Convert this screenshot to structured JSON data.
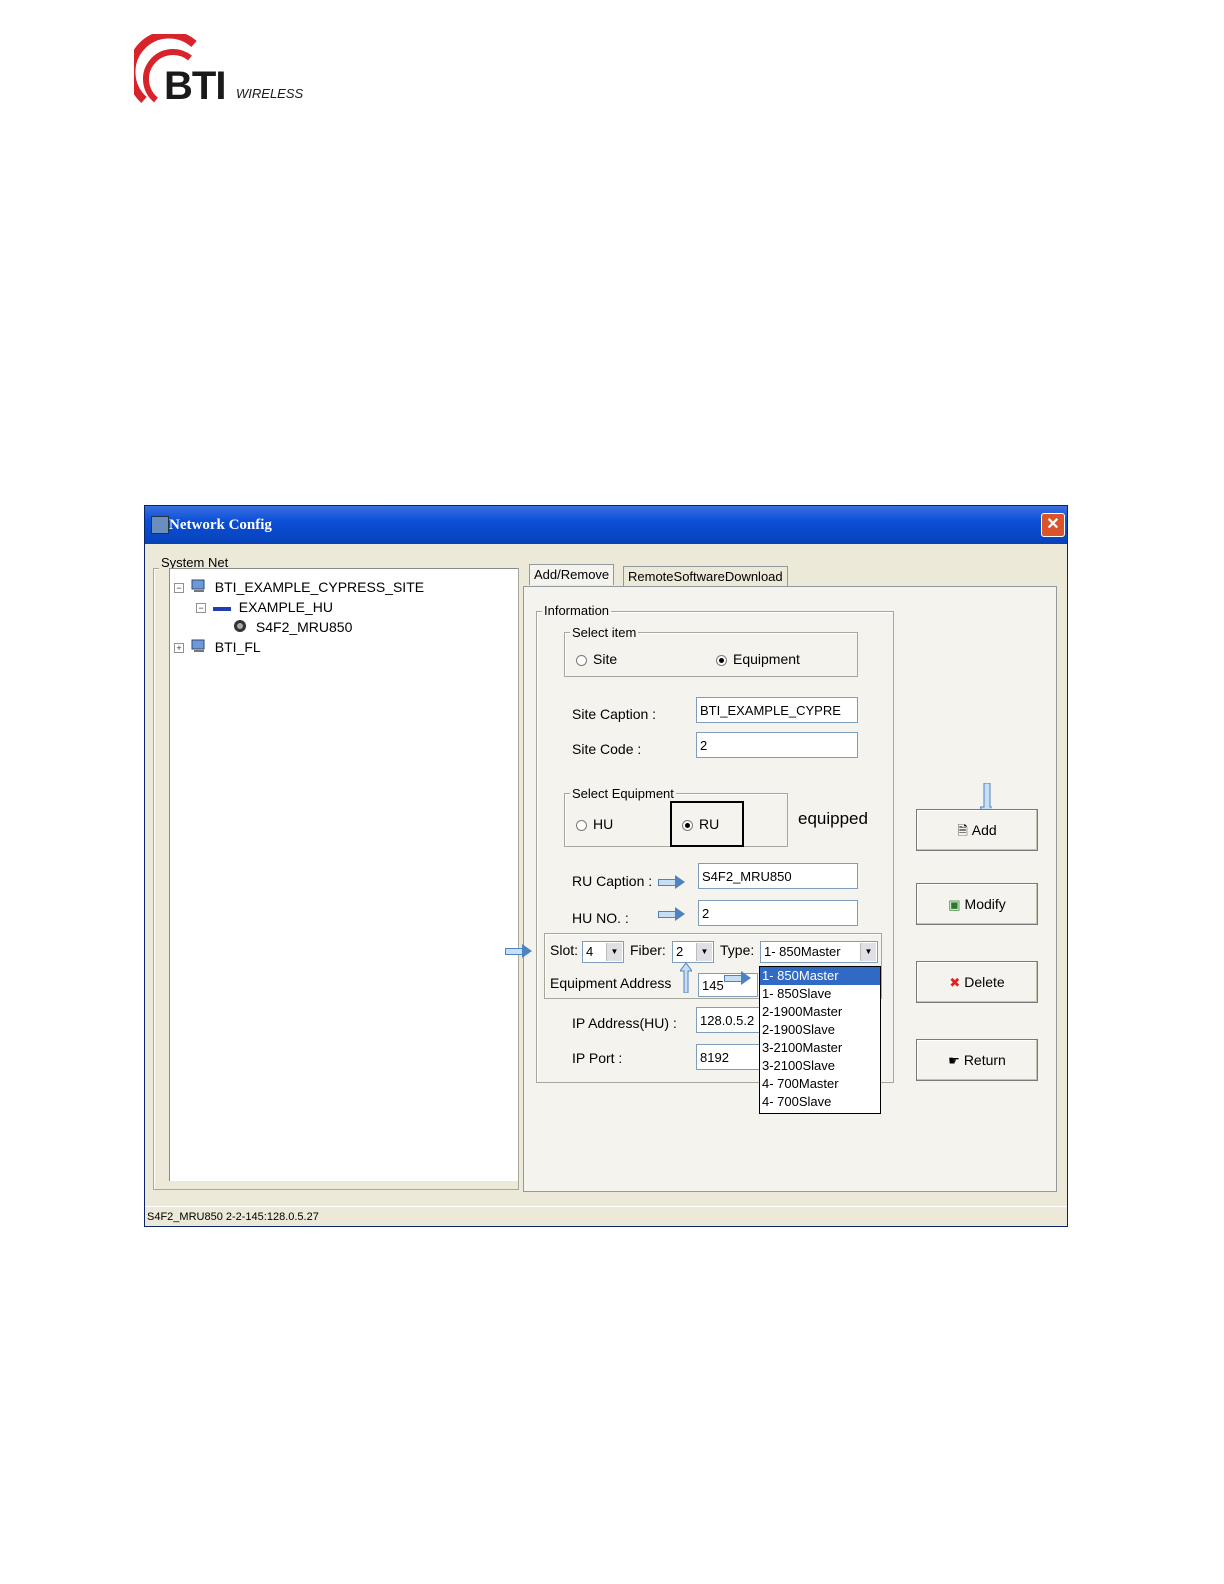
{
  "logo": {
    "main": "BTI",
    "sub": "WIRELESS"
  },
  "window": {
    "title": "Network Config"
  },
  "system_net": {
    "legend": "System Net",
    "tree": [
      {
        "label": "BTI_EXAMPLE_CYPRESS_SITE",
        "expander": "−"
      },
      {
        "label": "EXAMPLE_HU",
        "expander": "−"
      },
      {
        "label": "S4F2_MRU850"
      },
      {
        "label": "BTI_FL",
        "expander": "+"
      }
    ]
  },
  "tabs": [
    "Add/Remove",
    "RemoteSoftwareDownload"
  ],
  "information": {
    "legend": "Information",
    "select_item": {
      "legend": "Select item",
      "site": "Site",
      "equipment": "Equipment",
      "selected": "Equipment"
    },
    "site_caption_label": "Site Caption :",
    "site_caption_value": "BTI_EXAMPLE_CYPRE",
    "site_code_label": "Site Code :",
    "site_code_value": "2",
    "select_equipment": {
      "legend": "Select Equipment",
      "hu": "HU",
      "ru": "RU",
      "selected": "RU"
    },
    "equipped_label": "equipped",
    "ru_caption_label": "RU Caption :",
    "ru_caption_value": "S4F2_MRU850",
    "hu_no_label": "HU NO. :",
    "hu_no_value": "2",
    "slot_label": "Slot:",
    "slot_value": "4",
    "fiber_label": "Fiber:",
    "fiber_value": "2",
    "type_label": "Type:",
    "type_value": "1- 850Master",
    "type_options": [
      "1- 850Master",
      "1- 850Slave",
      "2-1900Master",
      "2-1900Slave",
      "3-2100Master",
      "3-2100Slave",
      "4- 700Master",
      "4- 700Slave"
    ],
    "equipment_address_label": "Equipment Address",
    "equipment_address_value": "145",
    "ip_address_label": "IP Address(HU) :",
    "ip_address_value": "128.0.5.2",
    "ip_port_label": "IP Port :",
    "ip_port_value": "8192"
  },
  "buttons": {
    "add": "Add",
    "modify": "Modify",
    "delete": "Delete",
    "return": "Return"
  },
  "status": "S4F2_MRU850 2-2-145:128.0.5.27",
  "colors": {
    "titlebar": "#0a4fd8",
    "window_bg": "#ece9d8",
    "selection": "#316ac5",
    "arrow": "#4f82c0"
  }
}
